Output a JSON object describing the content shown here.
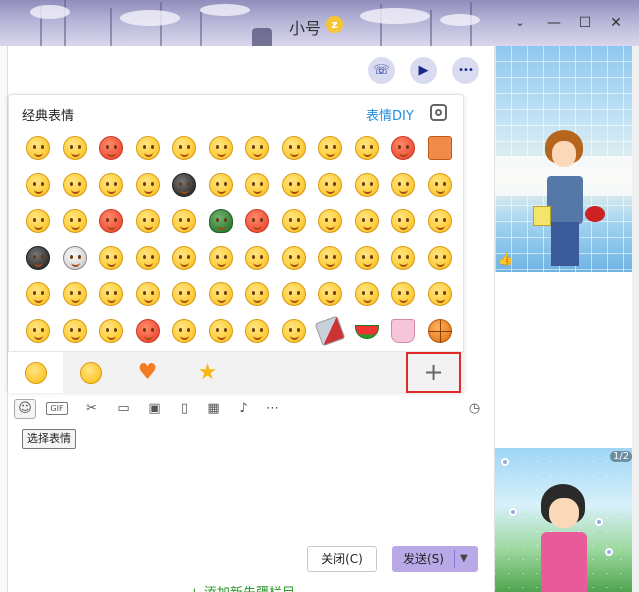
{
  "window": {
    "title": "小号",
    "title_badge": "z",
    "minimize_label": "—",
    "maximize_label": "☐",
    "close_label": "✕",
    "extra_label": "⌄"
  },
  "header_actions": {
    "phone_icon": "☏",
    "video_icon": "▶",
    "more_icon": "•••"
  },
  "emoji_panel": {
    "title": "经典表情",
    "diy_link": "表情DIY",
    "rows": 6,
    "columns": 12,
    "tabs": [
      {
        "name": "classic-emoji",
        "icon": "smile-face"
      },
      {
        "name": "emoji-set",
        "icon": "grin-face"
      },
      {
        "name": "favorites",
        "icon": "heart",
        "glyph": "♥"
      },
      {
        "name": "starred",
        "icon": "star",
        "glyph": "★"
      }
    ],
    "add_label": "+"
  },
  "toolbar": {
    "gif_label": "GIF",
    "scissors_icon": "✂",
    "folder_icon": "▭",
    "image_icon": "▣",
    "shake_icon": "▯",
    "calendar_icon": "▦",
    "music_icon": "♪",
    "more_icon": "⋯",
    "history_icon": "◷"
  },
  "tooltip": "选择表情",
  "buttons": {
    "close": "关闭(C)",
    "send": "发送(S)",
    "send_dropdown": "▼"
  },
  "bottom_link": "+ 添加新先疆栏目",
  "sidebar": {
    "show_counter": "1/2",
    "like_icon": "👍"
  },
  "colors": {
    "accent_diy": "#1e8ee0",
    "highlight_border": "#e02a2a",
    "send_button": "#b9a9e8",
    "heart": "#f57b25",
    "star": "#f5b81a"
  }
}
